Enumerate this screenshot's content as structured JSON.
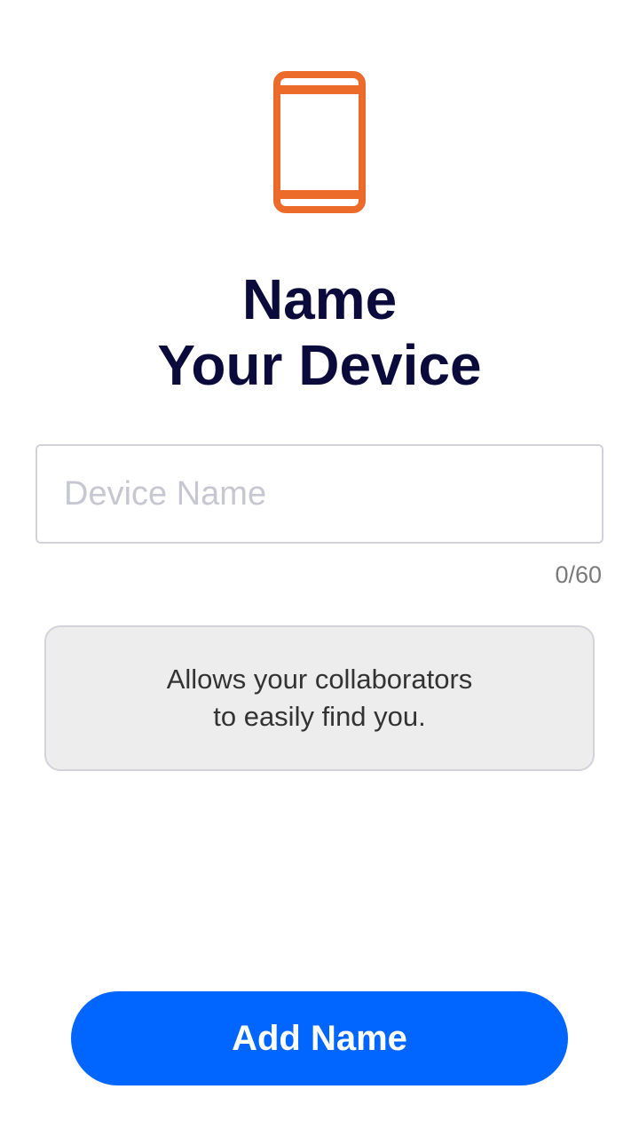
{
  "icon": {
    "name": "smartphone-icon",
    "color": "#ec6a2a"
  },
  "heading": {
    "line1": "Name",
    "line2": "Your Device"
  },
  "device_name_input": {
    "value": "",
    "placeholder": "Device Name"
  },
  "counter": "0/60",
  "info": {
    "line1": "Allows your collaborators",
    "line2": "to easily find you."
  },
  "add_button": {
    "label": "Add Name",
    "color": "#0066ff"
  }
}
